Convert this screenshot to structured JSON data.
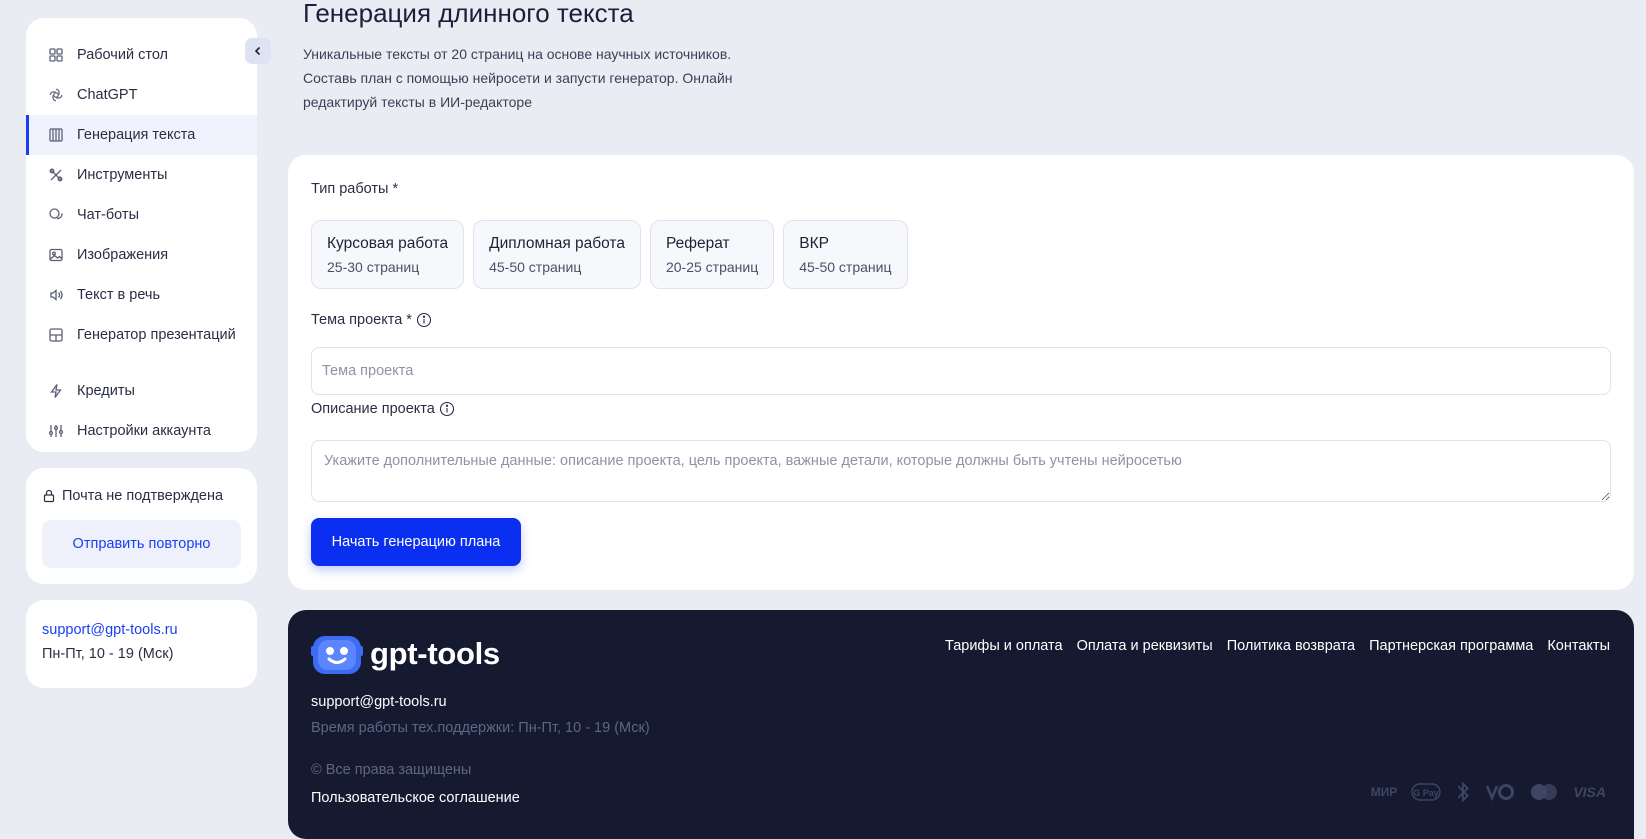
{
  "sidebar": {
    "items": [
      {
        "label": "Рабочий стол",
        "icon": "grid-icon"
      },
      {
        "label": "ChatGPT",
        "icon": "openai-icon"
      },
      {
        "label": "Генерация текста",
        "icon": "text-doc-icon"
      },
      {
        "label": "Инструменты",
        "icon": "tools-icon"
      },
      {
        "label": "Чат-боты",
        "icon": "chat-icon"
      },
      {
        "label": "Изображения",
        "icon": "image-icon"
      },
      {
        "label": "Текст в речь",
        "icon": "speaker-icon"
      },
      {
        "label": "Генератор презентаций",
        "icon": "presentation-icon"
      },
      {
        "label": "Кредиты",
        "icon": "lightning-icon"
      },
      {
        "label": "Настройки аккаунта",
        "icon": "sliders-icon"
      }
    ],
    "active_index": 2
  },
  "email_status": {
    "label": "Почта не подтверждена",
    "resend_label": "Отправить повторно"
  },
  "support": {
    "email": "support@gpt-tools.ru",
    "hours": "Пн-Пт, 10 - 19 (Мск)"
  },
  "header": {
    "title": "Генерация длинного текста",
    "description": "Уникальные тексты от 20 страниц на основе научных источников. Составь план с помощью нейросети и запусти генератор. Онлайн редактируй тексты в ИИ-редакторе"
  },
  "form": {
    "work_type_label": "Тип работы *",
    "work_types": [
      {
        "name": "Курсовая работа",
        "pages": "25-30 страниц"
      },
      {
        "name": "Дипломная работа",
        "pages": "45-50 страниц"
      },
      {
        "name": "Реферат",
        "pages": "20-25 страниц"
      },
      {
        "name": "ВКР",
        "pages": "45-50 страниц"
      }
    ],
    "topic_label": "Тема проекта *",
    "topic_placeholder": "Тема проекта",
    "topic_value": "",
    "description_label": "Описание проекта",
    "description_placeholder": "Укажите дополнительные данные: описание проекта, цель проекта, важные детали, которые должны быть учтены нейросетью",
    "description_value": "",
    "start_button": "Начать генерацию плана"
  },
  "footer": {
    "brand": "gpt-tools",
    "links": [
      "Тарифы и оплата",
      "Оплата и реквизиты",
      "Политика возврата",
      "Партнерская программа",
      "Контакты"
    ],
    "email": "support@gpt-tools.ru",
    "hours": "Время работы тех.поддержки: Пн-Пт, 10 - 19 (Мск)",
    "copyright": "© Все права защищены",
    "terms": "Пользовательское соглашение",
    "payments": [
      "МИР",
      "G Pay",
      "Bluetooth",
      "Visa-OD",
      "Mastercard",
      "VISA"
    ]
  },
  "colors": {
    "accent": "#0a2ff0",
    "background": "#eaecf4",
    "footer_bg": "#151a31"
  }
}
